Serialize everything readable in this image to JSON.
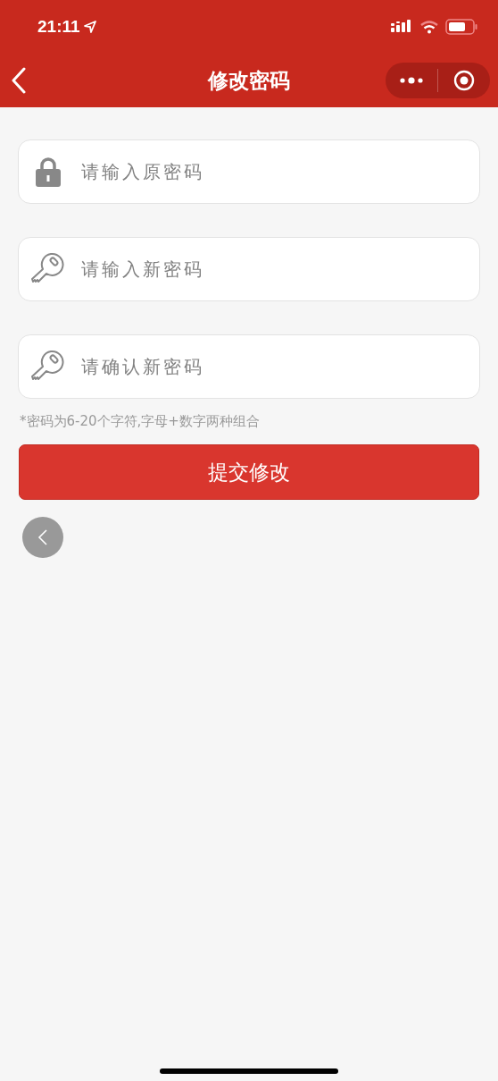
{
  "status_bar": {
    "time": "21:11"
  },
  "nav_bar": {
    "title": "修改密码"
  },
  "fields": [
    {
      "kind": "lock",
      "placeholder": "请输入原密码"
    },
    {
      "kind": "key",
      "placeholder": "请输入新密码"
    },
    {
      "kind": "key",
      "placeholder": "请确认新密码"
    }
  ],
  "hint": "*密码为6-20个字符,字母+数字两种组合",
  "submit_button": "提交修改"
}
